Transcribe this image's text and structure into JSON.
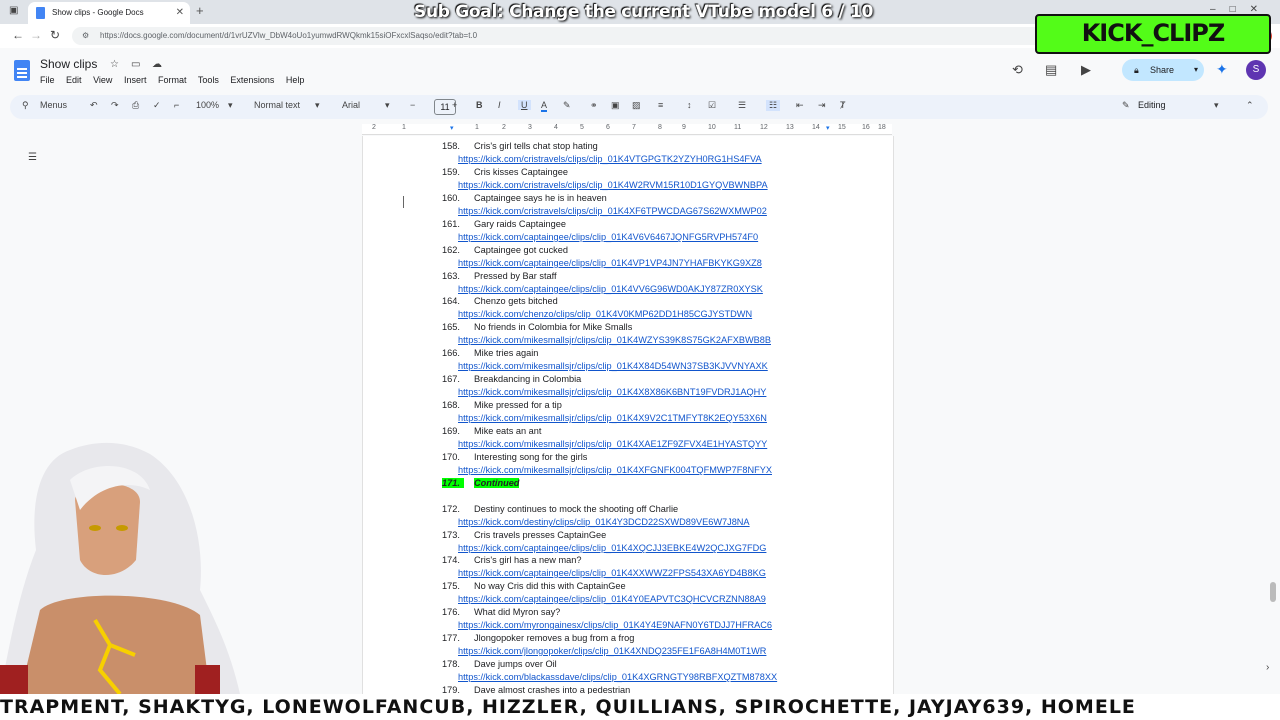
{
  "browser": {
    "tab_title": "Show clips - Google Docs",
    "url": "https://docs.google.com/document/d/1vrUZVlw_DbW4oUo1yumwdRWQkmk15siOFxcxlSaqso/edit?tab=t.0"
  },
  "overlay": {
    "sub_goal": "Sub Goal: Change the current VTube model  6 / 10",
    "brand": "KICK_CLIPZ",
    "ticker": "TRAPMENT, SHAKTYG, LONEWOLFANCUB, HIZZLER, QUILLIANS, SPIROCHETTE, JAYJAY639, HOMELE"
  },
  "doc": {
    "title": "Show clips",
    "menu": [
      "File",
      "Edit",
      "View",
      "Insert",
      "Format",
      "Tools",
      "Extensions",
      "Help"
    ],
    "share_label": "Share",
    "avatar_letter": "S"
  },
  "toolbar": {
    "menus_label": "Menus",
    "zoom": "100%",
    "style": "Normal text",
    "font": "Arial",
    "font_size": "11",
    "mode": "Editing"
  },
  "ruler_ticks": [
    "2",
    "1",
    "1",
    "2",
    "3",
    "4",
    "5",
    "6",
    "7",
    "8",
    "9",
    "10",
    "11",
    "12",
    "13",
    "14",
    "15",
    "16",
    "17",
    "18"
  ],
  "entries": [
    {
      "n": "158.",
      "title": "Cris's girl tells chat stop hating",
      "link": "https://kick.com/cristravels/clips/clip_01K4VTGPGTK2YZYH0RG1HS4FVA"
    },
    {
      "n": "159.",
      "title": "Cris kisses Captaingee",
      "link": "https://kick.com/cristravels/clips/clip_01K4W2RVM15R10D1GYQVBWNBPA"
    },
    {
      "n": "160.",
      "title": "Captaingee says he is in heaven",
      "link": "https://kick.com/cristravels/clips/clip_01K4XF6TPWCDAG67S62WXMWP02"
    },
    {
      "n": "161.",
      "title": "Gary raids Captaingee",
      "link": "https://kick.com/captaingee/clips/clip_01K4V6V6467JQNFG5RVPH574F0"
    },
    {
      "n": "162.",
      "title": "Captaingee got cucked",
      "link": "https://kick.com/captaingee/clips/clip_01K4VP1VP4JN7YHAFBKYKG9XZ8"
    },
    {
      "n": "163.",
      "title": "Pressed by Bar staff",
      "link": "https://kick.com/captaingee/clips/clip_01K4VV6G96WD0AKJY87ZR0XYSK"
    },
    {
      "n": "164.",
      "title": "Chenzo gets bitched",
      "link": "https://kick.com/chenzo/clips/clip_01K4V0KMP62DD1H85CGJYSTDWN"
    },
    {
      "n": "165.",
      "title": "No friends in Colombia for Mike Smalls",
      "link": "https://kick.com/mikesmallsjr/clips/clip_01K4WZYS39K8S75GK2AFXBWB8B"
    },
    {
      "n": "166.",
      "title": "Mike tries again",
      "link": "https://kick.com/mikesmallsjr/clips/clip_01K4X84D54WN37SB3KJVVNYAXK"
    },
    {
      "n": "167.",
      "title": "Breakdancing in Colombia",
      "link": "https://kick.com/mikesmallsjr/clips/clip_01K4X8X86K6BNT19FVDRJ1AQHY"
    },
    {
      "n": "168.",
      "title": "Mike pressed for a tip",
      "link": "https://kick.com/mikesmallsjr/clips/clip_01K4X9V2C1TMFYT8K2EQY53X6N"
    },
    {
      "n": "169.",
      "title": "Mike eats an ant",
      "link": "https://kick.com/mikesmallsjr/clips/clip_01K4XAE1ZF9ZFVX4E1HYASTQYY"
    },
    {
      "n": "170.",
      "title": "Interesting song for the girls",
      "link": "https://kick.com/mikesmallsjr/clips/clip_01K4XFGNFK004TQFMWP7F8NFYX"
    },
    {
      "n": "171.",
      "title": "Continued",
      "link": "",
      "highlight": true
    },
    {
      "n": "172.",
      "title": "Destiny continues to mock the shooting off Charlie",
      "link": "https://kick.com/destiny/clips/clip_01K4Y3DCD22SXWD89VE6W7J8NA"
    },
    {
      "n": "173.",
      "title": "Cris travels presses CaptainGee",
      "link": "https://kick.com/captaingee/clips/clip_01K4XQCJJ3EBKE4W2QCJXG7FDG"
    },
    {
      "n": "174.",
      "title": "Cris's girl has a new man?",
      "link": "https://kick.com/captaingee/clips/clip_01K4XXWWZ2FPS543XA6YD4B8KG"
    },
    {
      "n": "175.",
      "title": "No way Cris did this with CaptainGee",
      "link": "https://kick.com/captaingee/clips/clip_01K4Y0EAPVTC3QHCVCRZNN88A9"
    },
    {
      "n": "176.",
      "title": "What did Myron say?",
      "link": "https://kick.com/myrongainesx/clips/clip_01K4Y4E9NAFN0Y6TDJJ7HFRAC6"
    },
    {
      "n": "177.",
      "title": "Jlongopoker removes a bug from a frog",
      "link": "https://kick.com/jlongopoker/clips/clip_01K4XNDQ235FE1F6A8H4M0T1WR"
    },
    {
      "n": "178.",
      "title": "Dave jumps over Oil",
      "link": "https://kick.com/blackassdave/clips/clip_01K4XGRNGTY98RBFXQZTM878XX"
    },
    {
      "n": "179.",
      "title": "Dave almost crashes into a pedestrian",
      "link": ""
    }
  ]
}
